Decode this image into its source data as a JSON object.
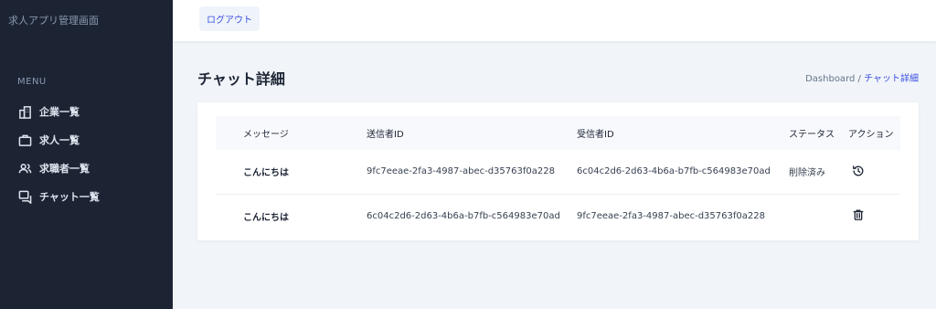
{
  "sidebar": {
    "app_title": "求人アプリ管理画面",
    "menu_heading": "MENU",
    "items": [
      {
        "label": "企業一覧",
        "icon": "building-icon"
      },
      {
        "label": "求人一覧",
        "icon": "briefcase-icon"
      },
      {
        "label": "求職者一覧",
        "icon": "users-icon"
      },
      {
        "label": "チャット一覧",
        "icon": "chat-icon"
      }
    ]
  },
  "header": {
    "logout_label": "ログアウト"
  },
  "page": {
    "title": "チャット詳細",
    "breadcrumb_root": "Dashboard /",
    "breadcrumb_current": "チャット詳細"
  },
  "table": {
    "headers": {
      "message": "メッセージ",
      "sender": "送信者ID",
      "receiver": "受信者ID",
      "status": "ステータス",
      "action": "アクション"
    },
    "rows": [
      {
        "message": "こんにちは",
        "sender": "9fc7eeae-2fa3-4987-abec-d35763f0a228",
        "receiver": "6c04c2d6-2d63-4b6a-b7fb-c564983e70ad",
        "status": "削除済み",
        "action_icon": "restore-icon"
      },
      {
        "message": "こんにちは",
        "sender": "6c04c2d6-2d63-4b6a-b7fb-c564983e70ad",
        "receiver": "9fc7eeae-2fa3-4987-abec-d35763f0a228",
        "status": "",
        "action_icon": "trash-icon"
      }
    ]
  },
  "colors": {
    "sidebar_bg": "#1c2434",
    "accent": "#3c50e0",
    "page_bg": "#f1f5f9"
  }
}
